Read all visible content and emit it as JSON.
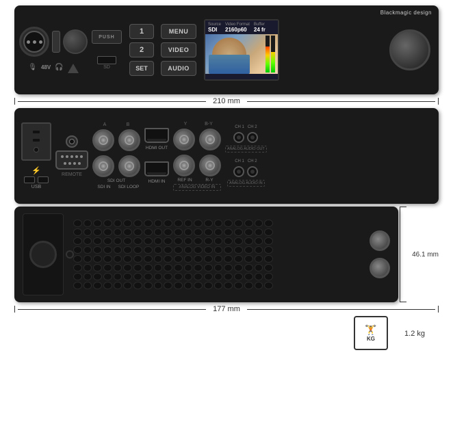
{
  "brand": "Blackmagic design",
  "front": {
    "push_label": "PUSH",
    "sd_label": "SD",
    "btn_1": "1",
    "btn_2": "2",
    "btn_set": "SET",
    "btn_menu": "MENU",
    "btn_video": "VIDEO",
    "btn_audio": "AUDIO",
    "lcd": {
      "source_label": "Source",
      "source_value": "SDI",
      "format_label": "Video Format",
      "format_value": "2160p60",
      "buffer_label": "Buffer",
      "buffer_value": "24 fr"
    },
    "v48_label": "48V"
  },
  "rear": {
    "remote_label": "REMOTE",
    "usb_label": "USB",
    "thunderbolt_label": "⚡",
    "sdi_out_label": "SDI OUT",
    "sdi_in_label": "SDI IN",
    "sdi_loop_label": "SDI LOOP",
    "hdmi_out_label": "HDMI OUT",
    "hdmi_in_label": "HDMI IN",
    "ref_in_label": "REF IN",
    "r_y_label": "R-Y",
    "b_y_label": "B-Y",
    "analog_video_in_label": "ANALOG VIDEO IN",
    "analog_audio_out_label": "ANALOG AUDIO OUT",
    "analog_audio_in_label": "ANALOG AUDIO IN",
    "ch1_label": "CH1",
    "ch2_label": "CH2",
    "a_label": "A",
    "b_label": "B",
    "y_label": "Y"
  },
  "dimensions": {
    "width_front": "210 mm",
    "width_side": "177 mm",
    "height_side": "46.1 mm"
  },
  "weight": {
    "label": "KG",
    "value": "1.2 kg"
  }
}
